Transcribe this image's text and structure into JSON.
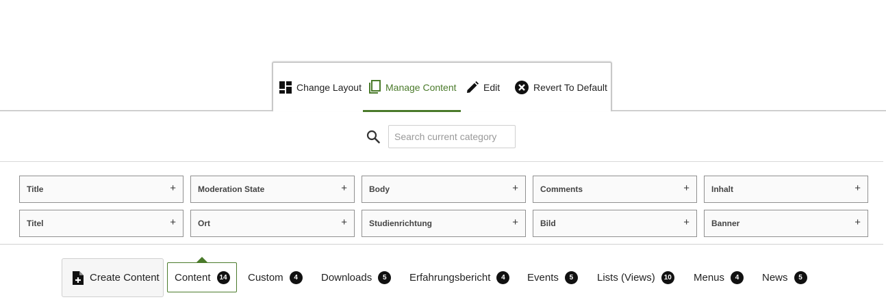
{
  "toolbar": {
    "change_layout": "Change Layout",
    "manage_content": "Manage Content",
    "edit": "Edit",
    "revert": "Revert To Default",
    "icons": [
      "layout-icon",
      "copy-icon",
      "pencil-icon",
      "close-circle-icon"
    ],
    "accent_color": "#4a7a2a"
  },
  "search": {
    "placeholder": "Search current category",
    "value": ""
  },
  "fields": [
    "Title",
    "Moderation State",
    "Body",
    "Comments",
    "Inhalt",
    "Titel",
    "Ort",
    "Studienrichtung",
    "Bild",
    "Banner"
  ],
  "field_add_symbol": "+",
  "create_content": "Create Content",
  "categories": [
    {
      "label": "Content",
      "count": "14"
    },
    {
      "label": "Custom",
      "count": "4"
    },
    {
      "label": "Downloads",
      "count": "5"
    },
    {
      "label": "Erfahrungsbericht",
      "count": "4"
    },
    {
      "label": "Events",
      "count": "5"
    },
    {
      "label": "Lists (Views)",
      "count": "10"
    },
    {
      "label": "Menus",
      "count": "4"
    },
    {
      "label": "News",
      "count": "5"
    }
  ]
}
